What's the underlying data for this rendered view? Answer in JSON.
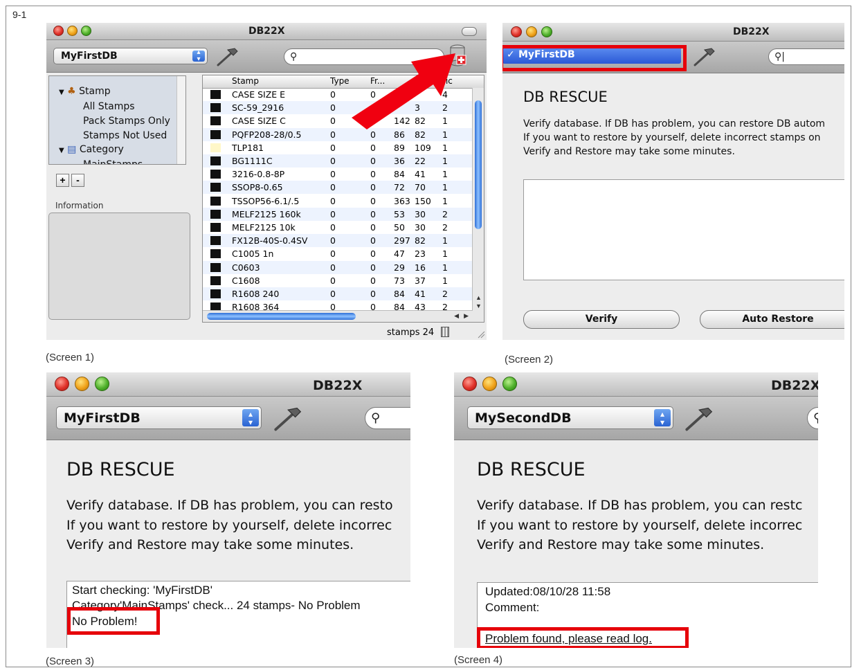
{
  "figure_label": "9-1",
  "captions": [
    "(Screen 1)",
    "(Screen 2)",
    "(Screen 3)",
    "(Screen 4)"
  ],
  "window_title": "DB22X",
  "screen1": {
    "db_selector": "MyFirstDB",
    "source_list": {
      "group_stamp": "Stamp",
      "items": [
        "All Stamps",
        "Pack Stamps Only",
        "Stamps Not Used"
      ],
      "group_category": "Category",
      "cut_item": "MainStamps",
      "add": "+",
      "remove": "-"
    },
    "info_label": "Information",
    "columns": [
      "Stamp",
      "Type",
      "Fr...",
      "",
      "",
      "Pic"
    ],
    "rows": [
      {
        "stamp": "CASE SIZE E",
        "type": "0",
        "fr": "0",
        "w": "",
        "h": "",
        "pic": "4"
      },
      {
        "stamp": "SC-59_2916",
        "type": "0",
        "fr": "",
        "w": "",
        "h": "3",
        "pic": "2"
      },
      {
        "stamp": "CASE SIZE C",
        "type": "0",
        "fr": "",
        "w": "142",
        "h": "82",
        "pic": "1"
      },
      {
        "stamp": "PQFP208-28/0.5",
        "type": "0",
        "fr": "0",
        "w": "86",
        "h": "82",
        "pic": "1"
      },
      {
        "stamp": "TLP181",
        "type": "0",
        "fr": "0",
        "w": "89",
        "h": "109",
        "pic": "1"
      },
      {
        "stamp": "BG1111C",
        "type": "0",
        "fr": "0",
        "w": "36",
        "h": "22",
        "pic": "1"
      },
      {
        "stamp": "3216-0.8-8P",
        "type": "0",
        "fr": "0",
        "w": "84",
        "h": "41",
        "pic": "1"
      },
      {
        "stamp": "SSOP8-0.65",
        "type": "0",
        "fr": "0",
        "w": "72",
        "h": "70",
        "pic": "1"
      },
      {
        "stamp": "TSSOP56-6.1/.5",
        "type": "0",
        "fr": "0",
        "w": "363",
        "h": "150",
        "pic": "1"
      },
      {
        "stamp": "MELF2125 160k",
        "type": "0",
        "fr": "0",
        "w": "53",
        "h": "30",
        "pic": "2"
      },
      {
        "stamp": "MELF2125 10k",
        "type": "0",
        "fr": "0",
        "w": "50",
        "h": "30",
        "pic": "2"
      },
      {
        "stamp": "FX12B-40S-0.4SV",
        "type": "0",
        "fr": "0",
        "w": "297",
        "h": "82",
        "pic": "1"
      },
      {
        "stamp": "C1005 1n",
        "type": "0",
        "fr": "0",
        "w": "47",
        "h": "23",
        "pic": "1"
      },
      {
        "stamp": "C0603",
        "type": "0",
        "fr": "0",
        "w": "29",
        "h": "16",
        "pic": "1"
      },
      {
        "stamp": "C1608",
        "type": "0",
        "fr": "0",
        "w": "73",
        "h": "37",
        "pic": "1"
      },
      {
        "stamp": "R1608 240",
        "type": "0",
        "fr": "0",
        "w": "84",
        "h": "41",
        "pic": "2"
      },
      {
        "stamp": "R1608 364",
        "type": "0",
        "fr": "0",
        "w": "84",
        "h": "43",
        "pic": "2"
      }
    ],
    "status": "stamps 24"
  },
  "screen2": {
    "db_selector": "MyFirstDB",
    "db_selector_check": "✓",
    "heading": "DB RESCUE",
    "lines": [
      "Verify database. If DB has problem, you can restore DB autom",
      "If you want to restore by yourself, delete incorrect stamps on",
      "Verify and Restore may take some minutes."
    ],
    "verify_button": "Verify",
    "auto_restore_button": "Auto Restore"
  },
  "screen3": {
    "db_selector": "MyFirstDB",
    "heading": "DB RESCUE",
    "lines": [
      "Verify database. If DB has problem, you can resto",
      "If you want to restore by yourself, delete incorrec",
      "Verify and Restore may take some minutes."
    ],
    "log": [
      "Start checking: 'MyFirstDB'",
      "Category'MainStamps' check... 24 stamps- No Problem",
      "No Problem!"
    ]
  },
  "screen4": {
    "db_selector": "MySecondDB",
    "heading": "DB RESCUE",
    "lines": [
      "Verify database. If DB has problem, you can restc",
      "If you want to restore by yourself, delete incorrec",
      "Verify and Restore may take some minutes."
    ],
    "log": [
      "Updated:08/10/28 11:58",
      "Comment:",
      "Problem found, please read log."
    ]
  },
  "colors": {
    "highlight": "#e6000a",
    "aqua": "#2a63d2",
    "row_alt": "#edf3fe"
  }
}
